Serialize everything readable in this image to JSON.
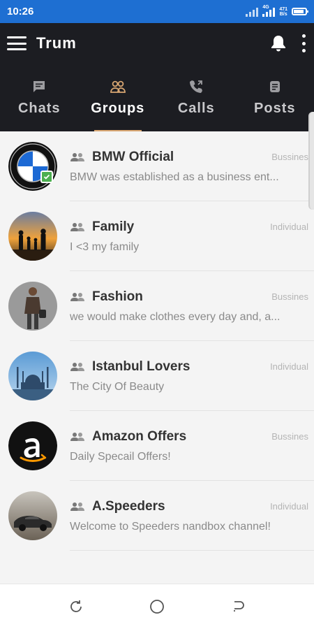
{
  "status_bar": {
    "time": "10:26",
    "net_speed_top": "471",
    "net_speed_bottom": "B/s",
    "net_type": "4G"
  },
  "app": {
    "title": "Trum"
  },
  "tabs": [
    {
      "label": "Chats",
      "icon": "chat-icon",
      "active": false
    },
    {
      "label": "Groups",
      "icon": "groups-icon",
      "active": true
    },
    {
      "label": "Calls",
      "icon": "phone-icon",
      "active": false
    },
    {
      "label": "Posts",
      "icon": "posts-icon",
      "active": false
    }
  ],
  "colors": {
    "header_bg": "#1c1d22",
    "status_bar_bg": "#1e6fd2",
    "active_tab_underline": "#d9a772",
    "active_tab_icon": "#d9a772",
    "verified_badge": "#4caf50"
  },
  "groups": [
    {
      "name": "BMW Official",
      "type": "Bussines",
      "preview": "BMW was established as a business ent...",
      "avatar": "bmw-logo",
      "verified": true
    },
    {
      "name": "Family",
      "type": "Individual",
      "preview": "I <3 my family",
      "avatar": "family-photo",
      "verified": false
    },
    {
      "name": "Fashion",
      "type": "Bussines",
      "preview": "we would make clothes every day and, a...",
      "avatar": "fashion-photo",
      "verified": false
    },
    {
      "name": "Istanbul Lovers",
      "type": "Individual",
      "preview": "The City Of Beauty",
      "avatar": "istanbul-photo",
      "verified": false
    },
    {
      "name": "Amazon Offers",
      "type": "Bussines",
      "preview": "Daily Specail Offers!",
      "avatar": "amazon-logo",
      "verified": false
    },
    {
      "name": "A.Speeders",
      "type": "Individual",
      "preview": "Welcome to Speeders nandbox channel!",
      "avatar": "car-photo",
      "verified": false
    }
  ],
  "nav_bar": [
    "recent-apps-icon",
    "home-icon",
    "back-icon"
  ]
}
